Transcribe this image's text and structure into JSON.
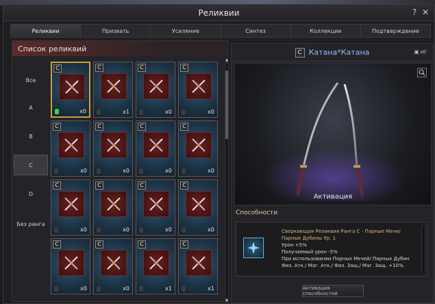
{
  "window": {
    "title": "Реликвии",
    "help_glyph": "?",
    "close_glyph": "✕"
  },
  "tabs": [
    {
      "label": "Реликвии",
      "active": true
    },
    {
      "label": "Призвать",
      "active": false
    },
    {
      "label": "Усиление",
      "active": false
    },
    {
      "label": "Синтез",
      "active": false
    },
    {
      "label": "Коллекции",
      "active": false
    },
    {
      "label": "Подтверждение",
      "active": false
    }
  ],
  "left": {
    "header": "Список реликвий",
    "ranks": [
      {
        "label": "Все",
        "active": false
      },
      {
        "label": "A",
        "active": false
      },
      {
        "label": "B",
        "active": false
      },
      {
        "label": "C",
        "active": true
      },
      {
        "label": "D",
        "active": false
      },
      {
        "label": "Без ранга",
        "active": false
      }
    ],
    "cards": [
      {
        "rank": "C",
        "count": "x0",
        "icon": "crossed-swords-icon",
        "gem": "green",
        "selected": true
      },
      {
        "rank": "C",
        "count": "x1",
        "icon": "axe-icon",
        "gem": "gray",
        "selected": false
      },
      {
        "rank": "C",
        "count": "x0",
        "icon": "dagger-icon",
        "gem": "gray",
        "selected": false
      },
      {
        "rank": "C",
        "count": "x0",
        "icon": "crossed-blades-icon",
        "gem": "gray",
        "selected": false
      },
      {
        "rank": "C",
        "count": "x0",
        "icon": "crossed-swords-icon",
        "gem": "gray",
        "selected": false
      },
      {
        "rank": "C",
        "count": "x0",
        "icon": "claw-icon",
        "gem": "gray",
        "selected": false
      },
      {
        "rank": "C",
        "count": "x0",
        "icon": "chakram-icon",
        "gem": "gray",
        "selected": false
      },
      {
        "rank": "C",
        "count": "x0",
        "icon": "bow-icon",
        "gem": "gray",
        "selected": false
      },
      {
        "rank": "C",
        "count": "x0",
        "icon": "halberd-icon",
        "gem": "gray",
        "selected": false
      },
      {
        "rank": "C",
        "count": "x0",
        "icon": "sword-icon",
        "gem": "gray",
        "selected": false
      },
      {
        "rank": "C",
        "count": "x0",
        "icon": "dagger-icon",
        "gem": "gray",
        "selected": false
      },
      {
        "rank": "C",
        "count": "x0",
        "icon": "spear-icon",
        "gem": "gray",
        "selected": false
      },
      {
        "rank": "C",
        "count": "x0",
        "icon": "throwing-star-icon",
        "gem": "gray",
        "selected": false
      },
      {
        "rank": "C",
        "count": "x0",
        "icon": "double-axe-icon",
        "gem": "gray",
        "selected": false
      },
      {
        "rank": "C",
        "count": "x1",
        "icon": "crystal-blade-icon",
        "gem": "gray",
        "selected": false
      },
      {
        "rank": "C",
        "count": "x1",
        "icon": "mace-icon",
        "gem": "gray",
        "selected": false
      }
    ]
  },
  "right": {
    "rank_badge": "C",
    "relic_name": "Катана*Катана",
    "bag_count": "x0",
    "preview_caption": "Активация",
    "abilities_header": "Способности",
    "ability_lines": [
      "Сверкающая Реликвия Ранга C - Парные Мечи/ Парные Дубины Ур. 1",
      "Урон +5%",
      "Получаемый урон -5%",
      "При использовании Парных Мечей/ Парных Дубин Физ. Атк./ Маг. Атк./ Физ. Защ./ Маг. Защ. +10%."
    ],
    "activate_button": "Активация способностей"
  },
  "colors": {
    "relic_name": "#9ab5ff",
    "selected_border": "#c9a040",
    "accent": "#5a2a2a"
  }
}
